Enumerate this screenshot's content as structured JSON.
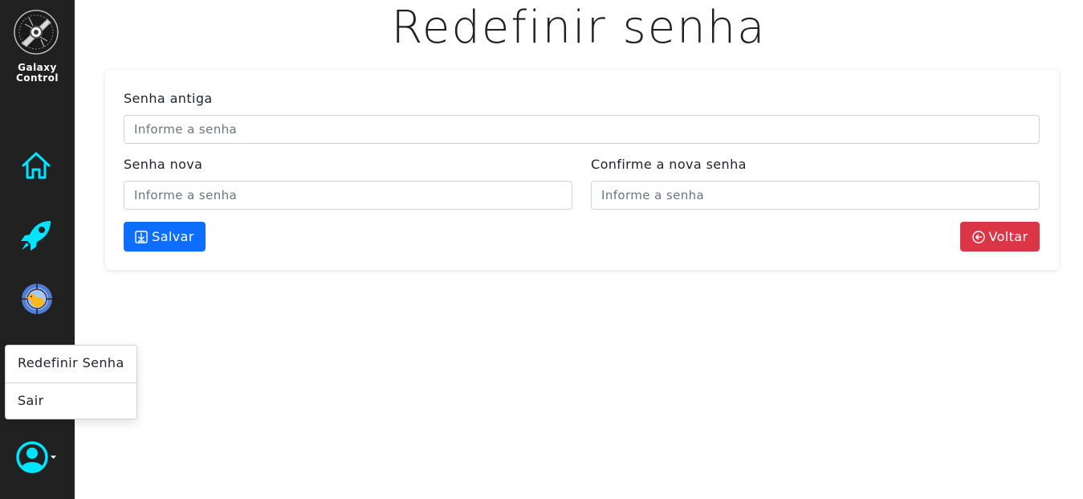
{
  "brand": {
    "line1": "Galaxy",
    "line2": "Control"
  },
  "nav_icons": [
    "home-icon",
    "rocket-icon",
    "target-icon",
    "user-circle-icon"
  ],
  "dropdown": {
    "items": [
      "Redefinir Senha",
      "Sair"
    ]
  },
  "page": {
    "title": "Redefinir senha"
  },
  "form": {
    "old_password": {
      "label": "Senha antiga",
      "placeholder": "Informe a senha",
      "value": ""
    },
    "new_password": {
      "label": "Senha nova",
      "placeholder": "Informe a senha",
      "value": ""
    },
    "confirm_password": {
      "label": "Confirme a nova senha",
      "placeholder": "Informe a senha",
      "value": ""
    },
    "save_label": "Salvar",
    "back_label": "Voltar"
  },
  "colors": {
    "sidebar": "#212121",
    "accent": "#00e5ff",
    "primary": "#0d6efd",
    "danger": "#dc3545"
  }
}
